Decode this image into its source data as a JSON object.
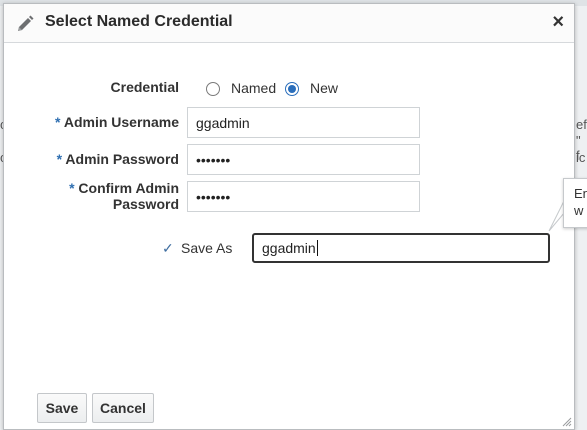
{
  "dialog": {
    "title": "Select Named Credential",
    "close_label": "×"
  },
  "form": {
    "credential_label": "Credential",
    "options": {
      "named": "Named",
      "new": "New",
      "selected": "New"
    },
    "admin_username": {
      "required_mark": "*",
      "label": "Admin Username",
      "value": "ggadmin"
    },
    "admin_password": {
      "required_mark": "*",
      "label": "Admin Password",
      "value": "•••••••"
    },
    "confirm_password": {
      "required_mark": "*",
      "label_line1": "Confirm Admin",
      "label_line2": "Password",
      "value": "•••••••"
    },
    "save_as": {
      "check": "✓",
      "label": "Save As",
      "value": "ggadmin"
    }
  },
  "tooltip": {
    "line1": "En",
    "line2": "w"
  },
  "background": {
    "frag1": "c",
    "frag2": "c",
    "frag3": "ef",
    "frag4": "\" f",
    "frag5": "ic"
  },
  "buttons": {
    "save": "Save",
    "cancel": "Cancel"
  },
  "colors": {
    "accent": "#2a6ebb",
    "required": "#2f6fb1"
  }
}
